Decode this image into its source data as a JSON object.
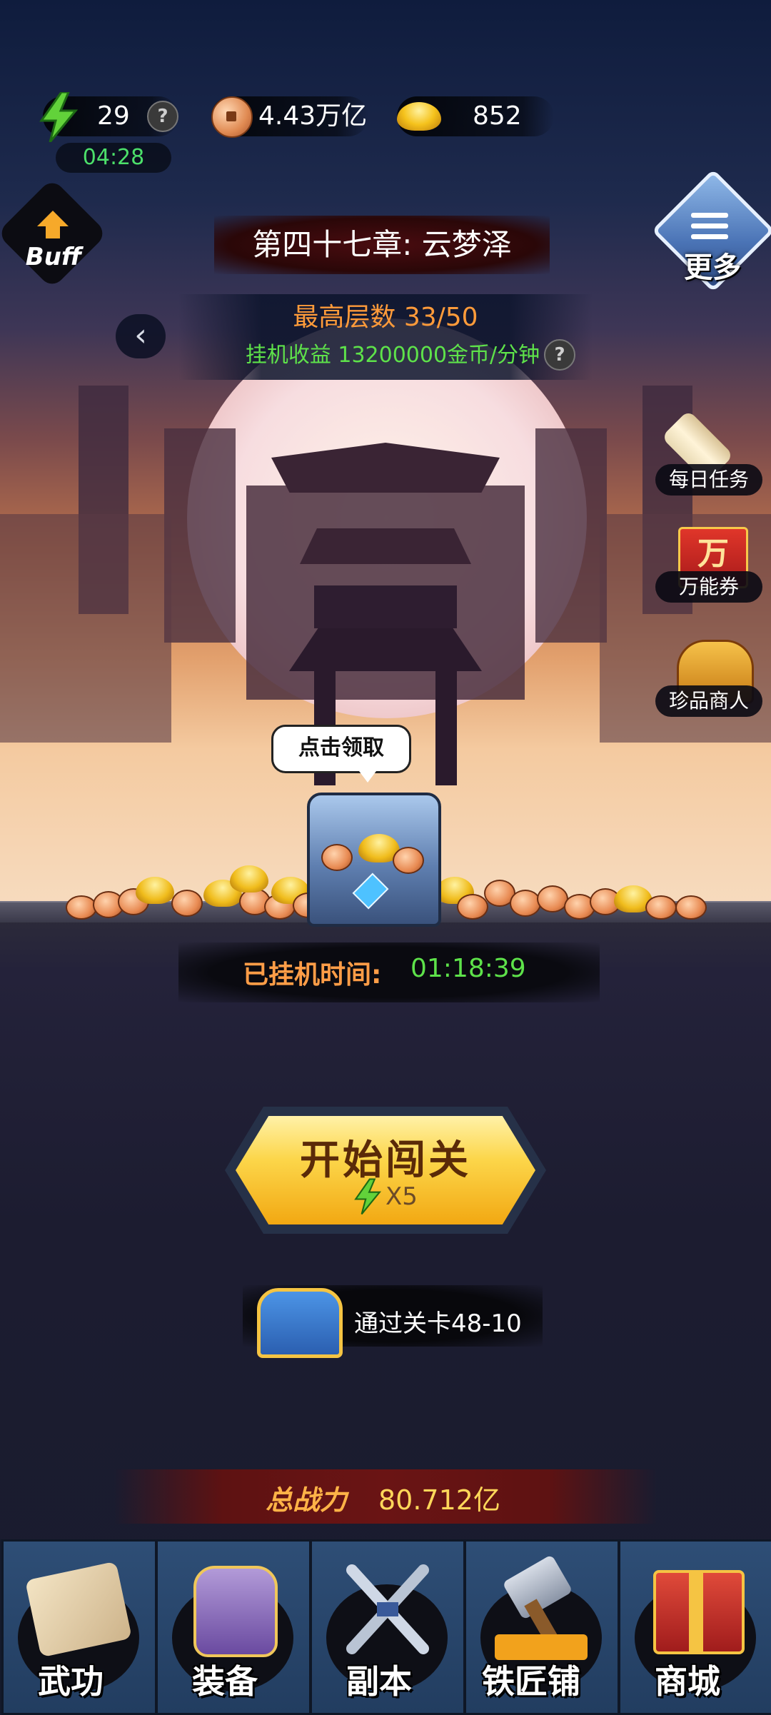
{
  "resources": {
    "energy": {
      "value": "29",
      "icon": "lightning-icon",
      "help": "?"
    },
    "energy_timer": "04:28",
    "copper": {
      "value": "4.43万亿",
      "icon": "copper-coin-icon"
    },
    "gold": {
      "value": "852",
      "icon": "gold-ingot-icon"
    }
  },
  "buff": {
    "label": "Buff"
  },
  "chapter": {
    "title": "第四十七章: 云梦泽"
  },
  "stage": {
    "max_floor": "最高层数 33/50",
    "idle_income": "挂机收益 13200000金币/分钟",
    "help": "?"
  },
  "more": {
    "label": "更多"
  },
  "side_menu": [
    {
      "label": "每日任务",
      "icon": "scroll-icon"
    },
    {
      "label": "万能券",
      "icon": "voucher-icon",
      "icon_text": "万"
    },
    {
      "label": "珍品商人",
      "icon": "treasure-merchant-icon"
    }
  ],
  "reward_tooltip": "点击领取",
  "idle_time": {
    "label": "已挂机时间:",
    "value": "01:18:39"
  },
  "start_button": {
    "label": "开始闯关",
    "cost": "X5"
  },
  "next_reward": {
    "text": "通过关卡48-10"
  },
  "power": {
    "label": "总战力",
    "value": "80.712亿"
  },
  "nav": [
    {
      "label": "武功",
      "icon": "martial-arts-scroll-icon"
    },
    {
      "label": "装备",
      "icon": "armor-icon"
    },
    {
      "label": "副本",
      "icon": "crossed-swords-icon"
    },
    {
      "label": "铁匠铺",
      "icon": "hammer-icon"
    },
    {
      "label": "商城",
      "icon": "gift-box-icon"
    }
  ],
  "colors": {
    "income_green": "#5ee24a",
    "highlight_orange": "#ff9b3a",
    "button_gold": "#fcd64a",
    "nav_blue": "#2e4e76"
  }
}
